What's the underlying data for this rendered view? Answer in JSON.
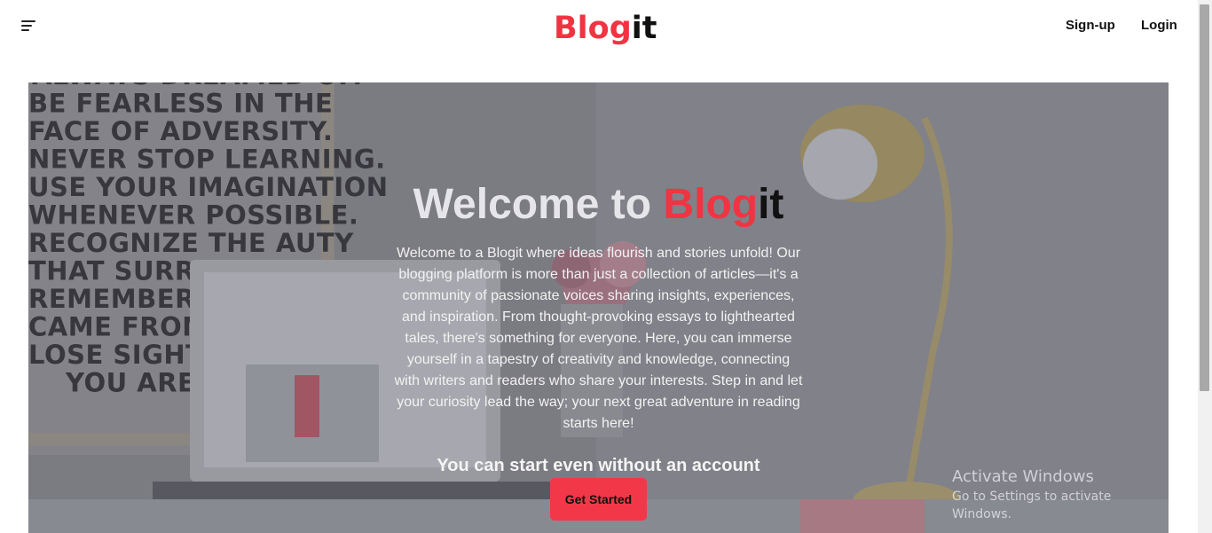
{
  "header": {
    "menu_icon": "hamburger-menu-icon",
    "logo_part1": "Blog",
    "logo_part2": "it",
    "signup_label": "Sign-up",
    "login_label": "Login"
  },
  "hero": {
    "title_prefix": "Welcome to ",
    "title_brand_part1": "Blog",
    "title_brand_part2": "it",
    "description": "Welcome to a Blogit where ideas flourish and stories unfold! Our blogging platform is more than just a collection of articles—it's a community of passionate voices sharing insights, experiences, and inspiration. From thought-provoking essays to lighthearted tales, there's something for everyone. Here, you can immerse yourself in a tapestry of creativity and knowledge, connecting with writers and readers who share your interests. Step in and let your curiosity lead the way; your next great adventure in reading starts here!",
    "subheading": "You can start even without an account",
    "cta_label": "Get Started",
    "poster_lines": [
      "ALWAYS DREAMED OF.",
      "BE FEARLESS IN THE",
      "FACE OF ADVERSITY.",
      "NEVER STOP LEARNING.",
      "USE YOUR IMAGINATION",
      "WHENEVER POSSIBLE.",
      "RECOGNIZE THE  AUTY",
      "THAT SURROUND",
      "REMEMBER WHI",
      "CAME FROM, BU",
      "LOSE SIGHT OF",
      "YOU ARE GO"
    ]
  },
  "watermark": {
    "line1": "Activate Windows",
    "line2": "Go to Settings to activate Windows."
  },
  "colors": {
    "brand_red": "#f23342",
    "cta_bg": "#f23848"
  }
}
